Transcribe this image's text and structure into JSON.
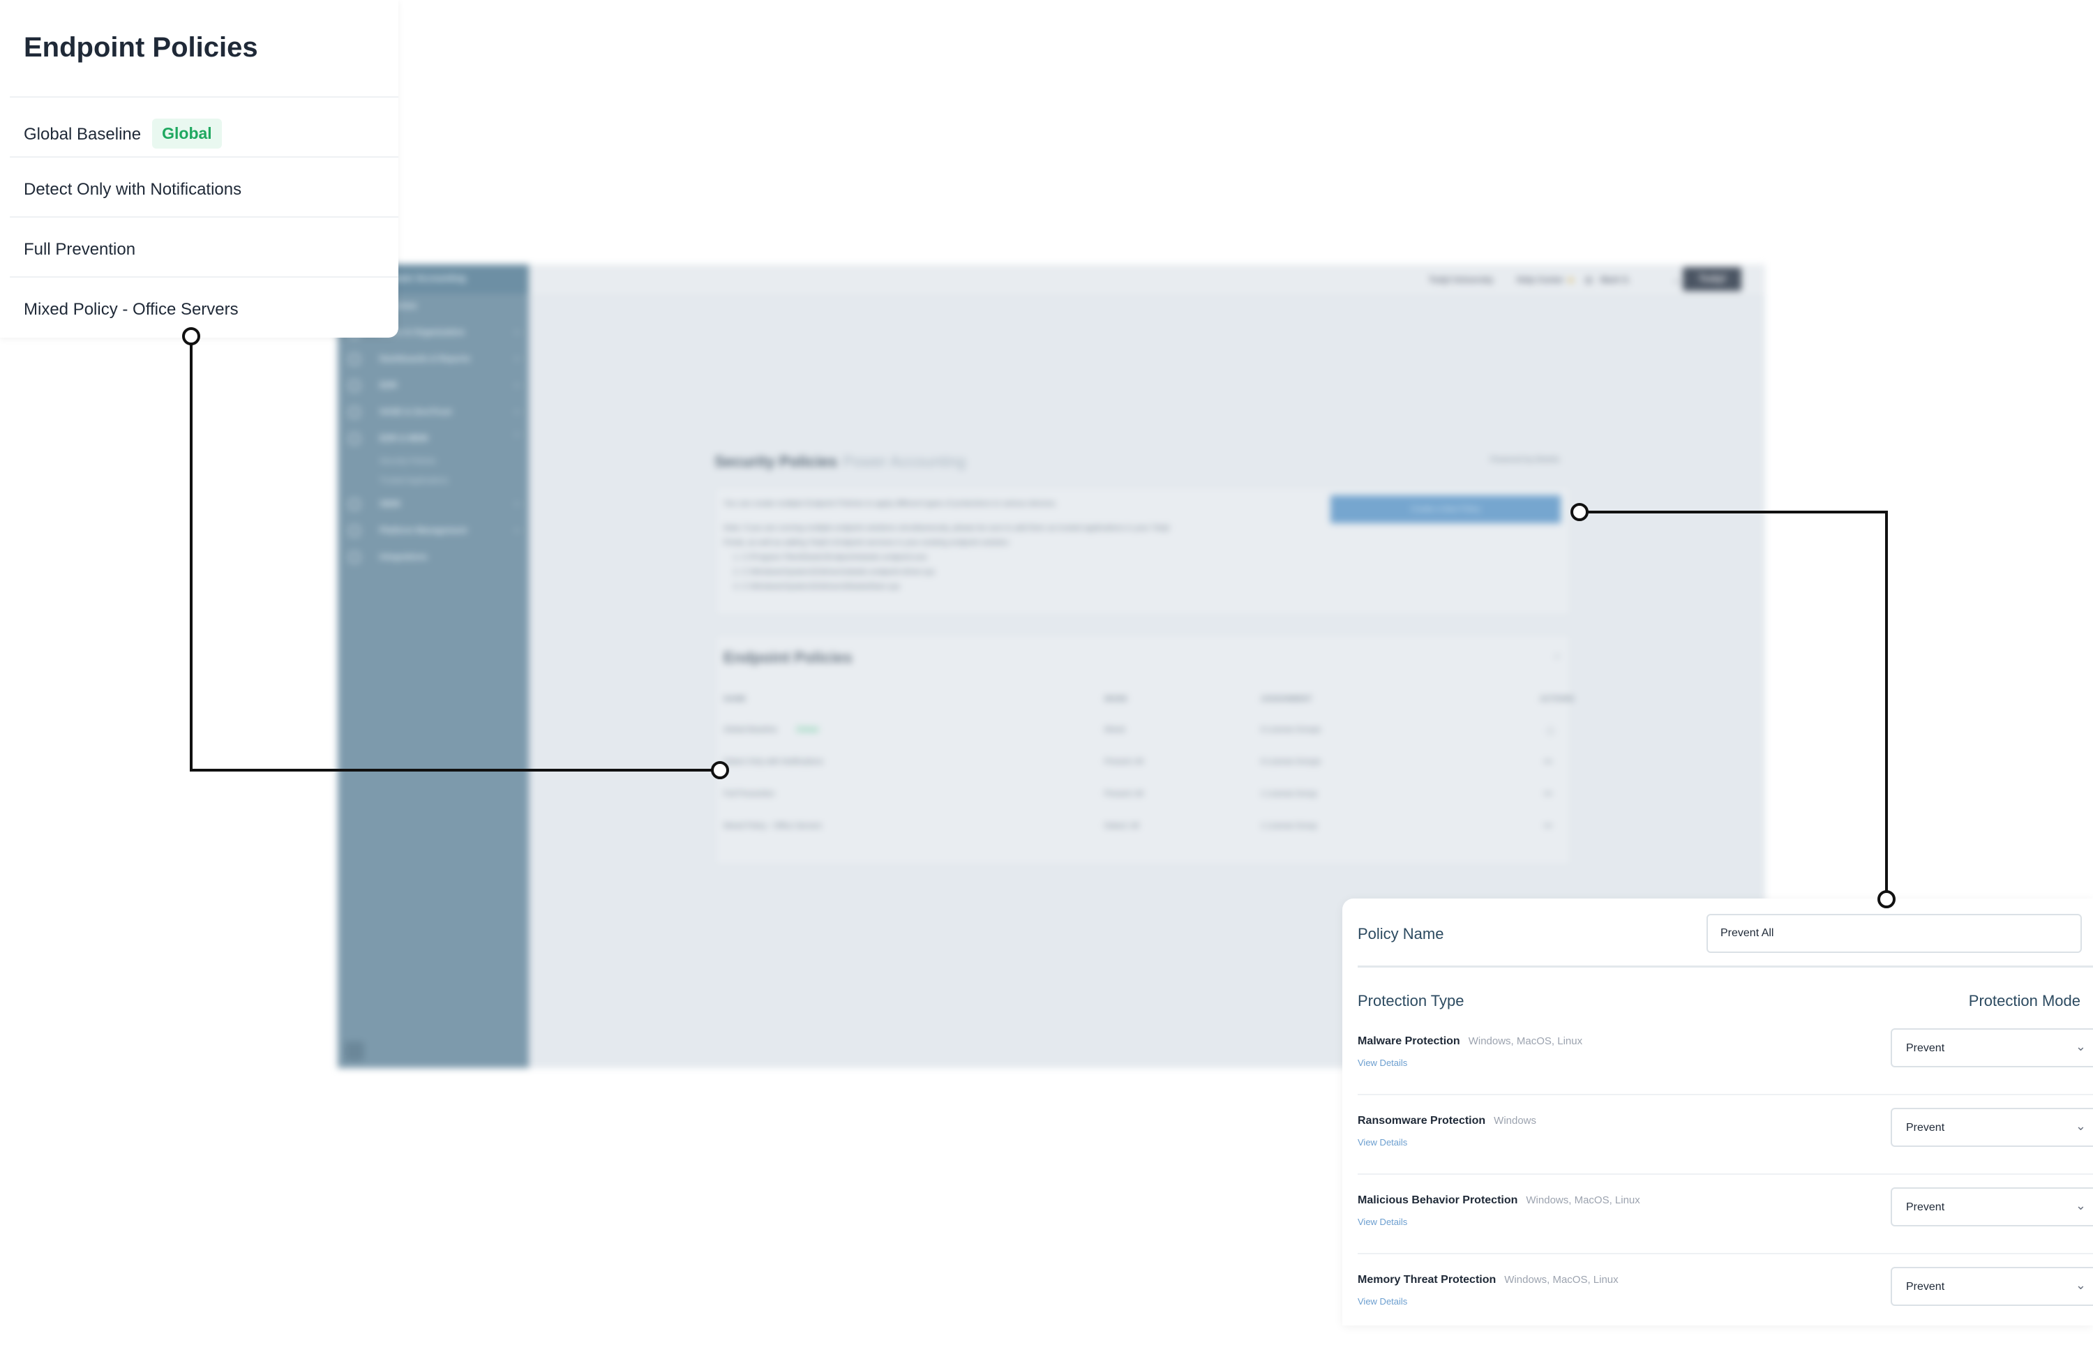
{
  "background_app": {
    "sidebar": {
      "header": "Power Accounting",
      "items": [
        {
          "label": "Overview",
          "icon": "home-icon"
        },
        {
          "label": "Users & Organization",
          "icon": "users-icon"
        },
        {
          "label": "Dashboards & Reports",
          "icon": "chart-icon"
        },
        {
          "label": "EDR",
          "icon": "shield-icon"
        },
        {
          "label": "SASE & ZeroTrust",
          "icon": "cloud-icon"
        },
        {
          "label": "EDR & MDM",
          "icon": "monitor-icon"
        },
        {
          "label": "SIEM",
          "icon": "document-icon"
        },
        {
          "label": "Platform Management",
          "icon": "gear-icon"
        },
        {
          "label": "Integrations",
          "icon": "plug-icon"
        }
      ],
      "subitems": [
        "Security Policies",
        "Trusted Applications"
      ]
    },
    "topbar": {
      "university_link": "Todyl University",
      "help_link": "Help Center",
      "user_name": "Mark S.",
      "logo": "Todyl"
    },
    "page": {
      "title": "Security Policies",
      "subtitle": "Power Accounting",
      "powered_by": "Powered by Elastic",
      "info_line": "You can create multiple Endpoint Policies to apply different types of protections to various devices.",
      "note_line_1": "Note: If you are running multiple endpoint solutions simultaneously, please be sure to add them as trusted applications in your Todyl",
      "note_line_2": "Portal, as well as adding Todyl's Endpoint services in your existing endpoint solution:",
      "paths": [
        "1. C:\\Program Files\\Elastic\\Endpoint\\elastic-endpoint.exe",
        "2. C:\\Windows\\System32\\drivers\\elastic-endpoint-driver.sys",
        "3. C:\\Windows\\System32\\drivers\\ElasticElam.sys"
      ],
      "create_button": "Create a New Policy",
      "table_title": "Endpoint Policies",
      "columns": [
        "NAME",
        "MODE",
        "ASSIGNMENT",
        "ACTIONS"
      ],
      "rows": [
        {
          "name": "Global Baseline",
          "badge": "Global",
          "mode": "Mixed",
          "assignment": "6 License Groups"
        },
        {
          "name": "Detect Only with Notifications",
          "mode": "Prevent: All",
          "assignment": "6 License Groups"
        },
        {
          "name": "Full Prevention",
          "mode": "Prevent: All",
          "assignment": "1 License Group"
        },
        {
          "name": "Mixed Policy - Office Servers",
          "mode": "Detect: All",
          "assignment": "1 License Group"
        }
      ]
    }
  },
  "policy_list_zoom": {
    "title": "Endpoint Policies",
    "items": [
      {
        "label": "Global Baseline",
        "badge": "Global"
      },
      {
        "label": "Detect Only with Notifications"
      },
      {
        "label": "Full Prevention"
      },
      {
        "label": "Mixed Policy - Office Servers"
      }
    ]
  },
  "policy_form_zoom": {
    "name_label": "Policy Name",
    "name_value": "Prevent All",
    "type_header": "Protection Type",
    "mode_header": "Protection Mode",
    "rows": [
      {
        "title": "Malware Protection",
        "os": "Windows, MacOS, Linux",
        "link": "View Details",
        "mode": "Prevent"
      },
      {
        "title": "Ransomware Protection",
        "os": "Windows",
        "link": "View Details",
        "mode": "Prevent"
      },
      {
        "title": "Malicious Behavior Protection",
        "os": "Windows, MacOS, Linux",
        "link": "View Details",
        "mode": "Prevent"
      },
      {
        "title": "Memory Threat Protection",
        "os": "Windows, MacOS, Linux",
        "link": "View Details",
        "mode": "Prevent"
      }
    ]
  },
  "colors": {
    "badge_green": "#1fa860",
    "badge_bg": "#e9f8f0",
    "link_blue": "#6b9ecf",
    "label_navy": "#2c4a60",
    "connector": "#111111"
  }
}
